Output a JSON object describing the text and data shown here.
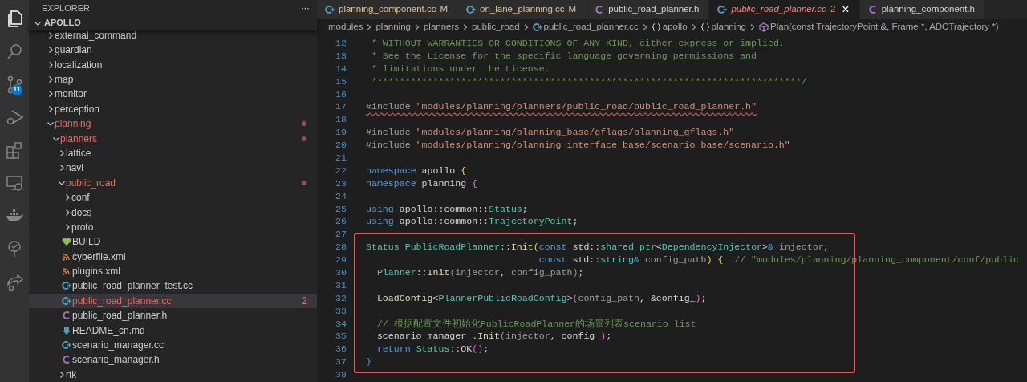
{
  "activity_bar": [
    {
      "kind": "files",
      "selected": true
    },
    {
      "kind": "search",
      "selected": false
    },
    {
      "kind": "source-control",
      "selected": false,
      "badge": "11"
    },
    {
      "kind": "run-debug",
      "selected": false
    },
    {
      "kind": "extensions",
      "selected": false
    },
    {
      "kind": "remote",
      "selected": false
    },
    {
      "kind": "whale",
      "selected": false
    },
    {
      "kind": "tree",
      "selected": false
    },
    {
      "kind": "share",
      "selected": false
    }
  ],
  "sidebar": {
    "title": "EXPLORER",
    "more": "···",
    "root": "APOLLO",
    "items": [
      {
        "label": "external_command",
        "kind": "folder",
        "expanded": false,
        "modified": false,
        "selected": false
      },
      {
        "label": "guardian",
        "kind": "folder",
        "expanded": false,
        "modified": false,
        "selected": false
      },
      {
        "label": "localization",
        "kind": "folder",
        "expanded": false,
        "modified": false,
        "selected": false
      },
      {
        "label": "map",
        "kind": "folder",
        "expanded": false,
        "modified": false,
        "selected": false
      },
      {
        "label": "monitor",
        "kind": "folder",
        "expanded": false,
        "modified": false,
        "selected": false
      },
      {
        "label": "perception",
        "kind": "folder",
        "expanded": false,
        "modified": false,
        "selected": false
      },
      {
        "label": "planning",
        "kind": "folder",
        "expanded": true,
        "modified": true,
        "selected": false,
        "children": [
          {
            "label": "planners",
            "kind": "folder",
            "expanded": true,
            "modified": true,
            "selected": false,
            "children": [
              {
                "label": "lattice",
                "kind": "folder",
                "expanded": false,
                "modified": false,
                "selected": false
              },
              {
                "label": "navi",
                "kind": "folder",
                "expanded": false,
                "modified": false,
                "selected": false
              },
              {
                "label": "public_road",
                "kind": "folder",
                "expanded": true,
                "modified": true,
                "selected": false,
                "children": [
                  {
                    "label": "conf",
                    "kind": "folder",
                    "expanded": false,
                    "modified": false,
                    "selected": false
                  },
                  {
                    "label": "docs",
                    "kind": "folder",
                    "expanded": false,
                    "modified": false,
                    "selected": false
                  },
                  {
                    "label": "proto",
                    "kind": "folder",
                    "expanded": false,
                    "modified": false,
                    "selected": false
                  },
                  {
                    "label": "BUILD",
                    "kind": "bazel",
                    "modified": false,
                    "selected": false
                  },
                  {
                    "label": "cyberfile.xml",
                    "kind": "xml",
                    "modified": false,
                    "selected": false
                  },
                  {
                    "label": "plugins.xml",
                    "kind": "xml",
                    "modified": false,
                    "selected": false
                  },
                  {
                    "label": "public_road_planner_test.cc",
                    "kind": "cc",
                    "modified": false,
                    "selected": false
                  },
                  {
                    "label": "public_road_planner.cc",
                    "kind": "cc",
                    "modified": true,
                    "selected": true,
                    "problems": "2"
                  },
                  {
                    "label": "public_road_planner.h",
                    "kind": "h",
                    "modified": false,
                    "selected": false
                  },
                  {
                    "label": "README_cn.md",
                    "kind": "md",
                    "modified": false,
                    "selected": false
                  },
                  {
                    "label": "scenario_manager.cc",
                    "kind": "cc",
                    "modified": false,
                    "selected": false
                  },
                  {
                    "label": "scenario_manager.h",
                    "kind": "h",
                    "modified": false,
                    "selected": false
                  }
                ]
              },
              {
                "label": "rtk",
                "kind": "folder",
                "expanded": false,
                "modified": false,
                "selected": false
              }
            ]
          }
        ]
      }
    ]
  },
  "tabs": [
    {
      "label": "planning_component.cc",
      "kind": "cc",
      "modified": true,
      "error": false,
      "badge": "M",
      "selected": false
    },
    {
      "label": "on_lane_planning.cc",
      "kind": "cc",
      "modified": true,
      "error": false,
      "badge": "M",
      "selected": false
    },
    {
      "label": "public_road_planner.h",
      "kind": "h",
      "modified": false,
      "error": false,
      "selected": false
    },
    {
      "label": "public_road_planner.cc",
      "kind": "cc",
      "modified": false,
      "error": true,
      "badge": "2",
      "selected": true,
      "close": "×"
    },
    {
      "label": "planning_component.h",
      "kind": "h",
      "modified": false,
      "error": false,
      "selected": false
    }
  ],
  "breadcrumbs": [
    {
      "label": "modules",
      "kind": "folder"
    },
    {
      "label": "planning",
      "kind": "folder"
    },
    {
      "label": "planners",
      "kind": "folder"
    },
    {
      "label": "public_road",
      "kind": "folder"
    },
    {
      "label": "public_road_planner.cc",
      "kind": "cc"
    },
    {
      "label": "apollo",
      "kind": "namespace"
    },
    {
      "label": "planning",
      "kind": "namespace"
    },
    {
      "label": "Plan(const TrajectoryPoint &, Frame *, ADCTrajectory *)",
      "kind": "method"
    }
  ],
  "editor": {
    "lines": [
      {
        "number": "12",
        "kind": "code",
        "tokens": [
          {
            "kind": "com",
            "text": " * WITHOUT WARRANTIES OR CONDITIONS OF ANY KIND, either express or implied."
          }
        ]
      },
      {
        "number": "13",
        "kind": "code",
        "tokens": [
          {
            "kind": "com",
            "text": " * See the License for the specific language governing permissions and"
          }
        ]
      },
      {
        "number": "14",
        "kind": "code",
        "tokens": [
          {
            "kind": "com",
            "text": " * limitations under the License."
          }
        ]
      },
      {
        "number": "15",
        "kind": "code",
        "tokens": [
          {
            "kind": "com",
            "text": " *****************************************************************************/"
          }
        ]
      },
      {
        "number": "16",
        "kind": "blank"
      },
      {
        "number": "17",
        "kind": "error",
        "tokens": [
          {
            "kind": "inc",
            "text": "#include "
          },
          {
            "kind": "str",
            "text": "\"modules/planning/planners/public_road/public_road_planner.h\""
          }
        ]
      },
      {
        "number": "18",
        "kind": "blank"
      },
      {
        "number": "19",
        "kind": "code",
        "tokens": [
          {
            "kind": "inc",
            "text": "#include "
          },
          {
            "kind": "str",
            "text": "\"modules/planning/planning_base/gflags/planning_gflags.h\""
          }
        ]
      },
      {
        "number": "20",
        "kind": "code",
        "tokens": [
          {
            "kind": "inc",
            "text": "#include "
          },
          {
            "kind": "str",
            "text": "\"modules/planning/planning_interface_base/scenario_base/scenario.h\""
          }
        ]
      },
      {
        "number": "21",
        "kind": "blank"
      },
      {
        "number": "22",
        "kind": "code",
        "tokens": [
          {
            "kind": "kw",
            "text": "namespace"
          },
          {
            "kind": "plain",
            "text": " apollo "
          },
          {
            "kind": "b1",
            "text": "{"
          }
        ]
      },
      {
        "number": "23",
        "kind": "code",
        "tokens": [
          {
            "kind": "kw",
            "text": "namespace"
          },
          {
            "kind": "plain",
            "text": " planning "
          },
          {
            "kind": "b2",
            "text": "{"
          }
        ]
      },
      {
        "number": "24",
        "kind": "blank"
      },
      {
        "number": "25",
        "kind": "code",
        "tokens": [
          {
            "kind": "kw",
            "text": "using"
          },
          {
            "kind": "plain",
            "text": " apollo::common::"
          },
          {
            "kind": "type",
            "text": "Status"
          },
          {
            "kind": "plain",
            "text": ";"
          }
        ]
      },
      {
        "number": "26",
        "kind": "code",
        "tokens": [
          {
            "kind": "kw",
            "text": "using"
          },
          {
            "kind": "plain",
            "text": " apollo::common::"
          },
          {
            "kind": "type",
            "text": "TrajectoryPoint"
          },
          {
            "kind": "plain",
            "text": ";"
          }
        ]
      },
      {
        "number": "27",
        "kind": "blank"
      }
    ],
    "highlighted_lines": [
      {
        "number": "28",
        "kind": "code",
        "tokens": [
          {
            "kind": "type",
            "text": "Status PublicRoadPlanner"
          },
          {
            "kind": "plain",
            "text": "::"
          },
          {
            "kind": "fn",
            "text": "Init"
          },
          {
            "kind": "b1",
            "text": "("
          },
          {
            "kind": "kw",
            "text": "const"
          },
          {
            "kind": "plain",
            "text": " std::"
          },
          {
            "kind": "type",
            "text": "shared_ptr"
          },
          {
            "kind": "plain",
            "text": "<"
          },
          {
            "kind": "type",
            "text": "DependencyInjector"
          },
          {
            "kind": "plain",
            "text": ">"
          },
          {
            "kind": "kw",
            "text": "&"
          },
          {
            "kind": "param",
            "text": " injector"
          },
          {
            "kind": "plain",
            "text": ","
          }
        ]
      },
      {
        "number": "29",
        "kind": "code",
        "tokens": [
          {
            "kind": "kw",
            "text": "                               const"
          },
          {
            "kind": "plain",
            "text": " std::"
          },
          {
            "kind": "type",
            "text": "string"
          },
          {
            "kind": "kw",
            "text": "&"
          },
          {
            "kind": "param",
            "text": " config_path"
          },
          {
            "kind": "b1",
            "text": ") {"
          },
          {
            "kind": "com",
            "text": "  // \"modules/planning/planning_component/conf/public"
          }
        ]
      },
      {
        "number": "30",
        "kind": "code",
        "tokens": [
          {
            "kind": "type",
            "text": "  Planner"
          },
          {
            "kind": "plain",
            "text": "::"
          },
          {
            "kind": "fn",
            "text": "Init"
          },
          {
            "kind": "b2",
            "text": "("
          },
          {
            "kind": "param",
            "text": "injector"
          },
          {
            "kind": "plain",
            "text": ", "
          },
          {
            "kind": "param",
            "text": "config_path"
          },
          {
            "kind": "b2",
            "text": ")"
          },
          {
            "kind": "plain",
            "text": ";"
          }
        ]
      },
      {
        "number": "31",
        "kind": "blank"
      },
      {
        "number": "32",
        "kind": "code",
        "tokens": [
          {
            "kind": "fn",
            "text": "  LoadConfig"
          },
          {
            "kind": "plain",
            "text": "<"
          },
          {
            "kind": "type",
            "text": "PlannerPublicRoadConfig"
          },
          {
            "kind": "plain",
            "text": ">"
          },
          {
            "kind": "b2",
            "text": "("
          },
          {
            "kind": "param",
            "text": "config_path"
          },
          {
            "kind": "plain",
            "text": ", &config_"
          },
          {
            "kind": "b2",
            "text": ")"
          },
          {
            "kind": "plain",
            "text": ";"
          }
        ]
      },
      {
        "number": "33",
        "kind": "blank"
      },
      {
        "number": "34",
        "kind": "code",
        "tokens": [
          {
            "kind": "com",
            "text": "  // 根据配置文件初始化PublicRoadPlanner的场景列表scenario_list"
          }
        ]
      },
      {
        "number": "35",
        "kind": "code",
        "tokens": [
          {
            "kind": "plain",
            "text": "  scenario_manager_."
          },
          {
            "kind": "fn",
            "text": "Init"
          },
          {
            "kind": "b2",
            "text": "("
          },
          {
            "kind": "param",
            "text": "injector"
          },
          {
            "kind": "plain",
            "text": ", config_"
          },
          {
            "kind": "b2",
            "text": ")"
          },
          {
            "kind": "plain",
            "text": ";"
          }
        ]
      },
      {
        "number": "36",
        "kind": "code",
        "tokens": [
          {
            "kind": "kw",
            "text": "  return"
          },
          {
            "kind": "type",
            "text": " Status"
          },
          {
            "kind": "plain",
            "text": "::OK"
          },
          {
            "kind": "b2",
            "text": "()"
          },
          {
            "kind": "plain",
            "text": ";"
          }
        ]
      },
      {
        "number": "37",
        "kind": "code",
        "tokens": [
          {
            "kind": "b3",
            "text": "}"
          }
        ]
      }
    ],
    "trailing_lines": [
      {
        "number": "38",
        "kind": "blank"
      }
    ]
  }
}
